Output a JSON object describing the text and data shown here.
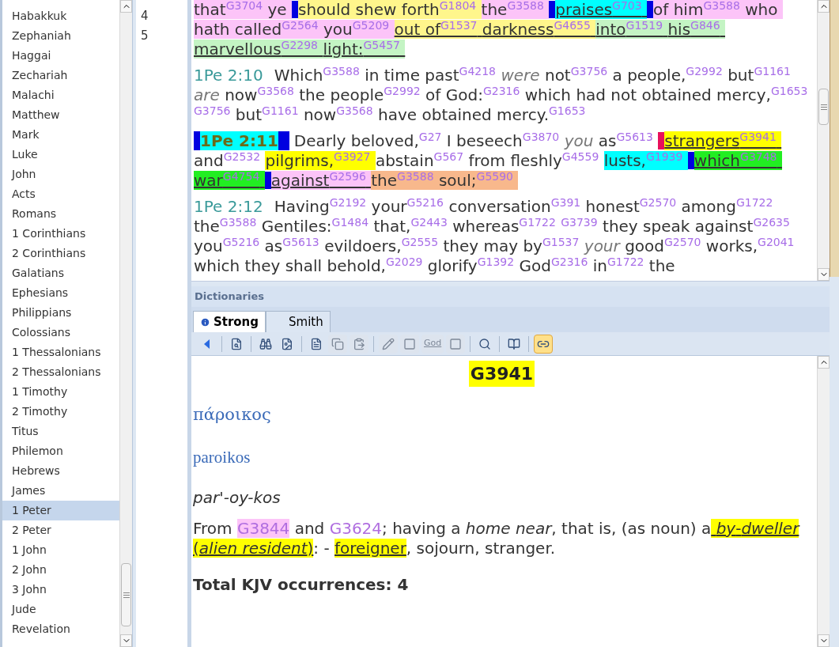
{
  "books": [
    {
      "name": "Habakkuk",
      "selected": false
    },
    {
      "name": "Zephaniah",
      "selected": false
    },
    {
      "name": "Haggai",
      "selected": false
    },
    {
      "name": "Zechariah",
      "selected": false
    },
    {
      "name": "Malachi",
      "selected": false
    },
    {
      "name": "Matthew",
      "selected": false
    },
    {
      "name": "Mark",
      "selected": false
    },
    {
      "name": "Luke",
      "selected": false
    },
    {
      "name": "John",
      "selected": false
    },
    {
      "name": "Acts",
      "selected": false
    },
    {
      "name": "Romans",
      "selected": false
    },
    {
      "name": "1 Corinthians",
      "selected": false
    },
    {
      "name": "2 Corinthians",
      "selected": false
    },
    {
      "name": "Galatians",
      "selected": false
    },
    {
      "name": "Ephesians",
      "selected": false
    },
    {
      "name": "Philippians",
      "selected": false
    },
    {
      "name": "Colossians",
      "selected": false
    },
    {
      "name": "1 Thessalonians",
      "selected": false
    },
    {
      "name": "2 Thessalonians",
      "selected": false
    },
    {
      "name": "1 Timothy",
      "selected": false
    },
    {
      "name": "2 Timothy",
      "selected": false
    },
    {
      "name": "Titus",
      "selected": false
    },
    {
      "name": "Philemon",
      "selected": false
    },
    {
      "name": "Hebrews",
      "selected": false
    },
    {
      "name": "James",
      "selected": false
    },
    {
      "name": "1 Peter",
      "selected": true
    },
    {
      "name": "2 Peter",
      "selected": false
    },
    {
      "name": "1 John",
      "selected": false
    },
    {
      "name": "2 John",
      "selected": false
    },
    {
      "name": "3 John",
      "selected": false
    },
    {
      "name": "Jude",
      "selected": false
    },
    {
      "name": "Revelation",
      "selected": false
    }
  ],
  "chapters": [
    "4",
    "5"
  ],
  "verses": [
    {
      "tokens": [
        {
          "kind": "word",
          "w": "that",
          "s": "G3704",
          "color": "#fcc4f8"
        },
        {
          "kind": "word",
          "w": "ye",
          "color": "#fcc4f8"
        },
        {
          "kind": "bar",
          "color": "#0000e0"
        },
        {
          "kind": "word",
          "w": "should shew forth",
          "s": "G1804",
          "color": "#fff68c"
        },
        {
          "kind": "word",
          "w": "the",
          "s": "G3588",
          "color": "#fcc4f8"
        },
        {
          "kind": "bar",
          "color": "#0000e0"
        },
        {
          "kind": "underlined",
          "w": "praises",
          "s": "G703",
          "color": "#00ffff"
        },
        {
          "kind": "bar",
          "color": "#0000e0"
        },
        {
          "kind": "word",
          "w": "of him",
          "s": "G3588",
          "color": "#fcc4f8"
        },
        {
          "kind": "word",
          "w": "who",
          "color": "#fcc4f8"
        },
        {
          "kind": "word",
          "w": "hath called",
          "s": "G2564",
          "color": "#fcc4f8"
        },
        {
          "kind": "word",
          "w": "you",
          "s": "G5209",
          "color": "#fcc4f8"
        },
        {
          "kind": "underlined",
          "w": "out of",
          "s": "G1537",
          "color": "#fff68c"
        },
        {
          "kind": "underlined",
          "w": "darkness",
          "s": "G4655",
          "color": "#fff68c"
        },
        {
          "kind": "underlined",
          "w": "into",
          "s": "G1519",
          "color": "#c4f4c4"
        },
        {
          "kind": "underlined",
          "w": "his",
          "s": "G846",
          "color": "#c4f4c4"
        },
        {
          "kind": "underlined",
          "w": "marvellous",
          "s": "G2298",
          "color": "#c4f4c4"
        },
        {
          "kind": "underlined",
          "w": "light:",
          "s": "G5457",
          "color": "#c4f4c4"
        }
      ]
    },
    {
      "ref": "1Pe 2:10",
      "selected": false,
      "tokens": [
        {
          "kind": "word",
          "w": "Which",
          "s": "G3588"
        },
        {
          "kind": "word",
          "w": "in time past",
          "s": "G4218"
        },
        {
          "kind": "italic",
          "w": "were"
        },
        {
          "kind": "word",
          "w": "not",
          "s": "G3756"
        },
        {
          "kind": "word",
          "w": "a people,",
          "s": "G2992"
        },
        {
          "kind": "word",
          "w": "but",
          "s": "G1161"
        },
        {
          "kind": "italic",
          "w": "are"
        },
        {
          "kind": "word",
          "w": "now",
          "s": "G3568"
        },
        {
          "kind": "word",
          "w": "the people",
          "s": "G2992"
        },
        {
          "kind": "word",
          "w": "of God:",
          "s": "G2316"
        },
        {
          "kind": "word",
          "w": "which had not obtained"
        },
        {
          "kind": "word",
          "w": "mercy,",
          "s": "G1653"
        },
        {
          "kind": "word",
          "s": "G3756"
        },
        {
          "kind": "word",
          "w": "but",
          "s": "G1161"
        },
        {
          "kind": "word",
          "w": "now",
          "s": "G3568"
        },
        {
          "kind": "word",
          "w": "have obtained mercy.",
          "s": "G1653"
        }
      ]
    },
    {
      "ref": "1Pe 2:11",
      "selected": true,
      "tokens": [
        {
          "kind": "word",
          "w": "Dearly beloved,",
          "s": "G27"
        },
        {
          "kind": "word",
          "w": "I beseech",
          "s": "G3870"
        },
        {
          "kind": "italic",
          "w": "you"
        },
        {
          "kind": "word",
          "w": "as",
          "s": "G5613"
        },
        {
          "kind": "bar",
          "color": "#e8105c"
        },
        {
          "kind": "underlined",
          "w": "strangers",
          "s": "G3941",
          "color": "#ffff00"
        },
        {
          "kind": "word",
          "w": "and",
          "s": "G2532"
        },
        {
          "kind": "word",
          "w": "pilgrims,",
          "s": "G3927",
          "color": "#ffff00"
        },
        {
          "kind": "word",
          "w": "abstain",
          "s": "G567"
        },
        {
          "kind": "word",
          "w": "from fleshly",
          "s": "G4559"
        },
        {
          "kind": "word",
          "w": "lusts,",
          "s": "G1939",
          "color": "#00ffff"
        },
        {
          "kind": "bar",
          "color": "#0000e0"
        },
        {
          "kind": "underlined",
          "w": "which",
          "s": "G3748",
          "color": "#22ee22"
        },
        {
          "kind": "underlined",
          "w": "war",
          "s": "G4754",
          "color": "#22ee22"
        },
        {
          "kind": "bar",
          "color": "#0000e0"
        },
        {
          "kind": "underlined",
          "w": "against",
          "s": "G2596",
          "color": "#fcc4f8"
        },
        {
          "kind": "word",
          "w": "the",
          "s": "G3588",
          "color": "#f8b88c"
        },
        {
          "kind": "word",
          "w": "soul;",
          "s": "G5590",
          "color": "#f8b88c"
        }
      ]
    },
    {
      "ref": "1Pe 2:12",
      "selected": false,
      "tokens": [
        {
          "kind": "word",
          "w": "Having",
          "s": "G2192"
        },
        {
          "kind": "word",
          "w": "your",
          "s": "G5216"
        },
        {
          "kind": "word",
          "w": "conversation",
          "s": "G391"
        },
        {
          "kind": "word",
          "w": "honest",
          "s": "G2570"
        },
        {
          "kind": "word",
          "w": "among",
          "s": "G1722"
        },
        {
          "kind": "word",
          "w": "the",
          "s": "G3588"
        },
        {
          "kind": "word",
          "w": "Gentiles:",
          "s": "G1484"
        },
        {
          "kind": "word",
          "w": "that,",
          "s": "G2443"
        },
        {
          "kind": "word",
          "w": "whereas",
          "s": "G1722"
        },
        {
          "kind": "word",
          "s": "G3739"
        },
        {
          "kind": "word",
          "w": "they speak against",
          "s": "G2635"
        },
        {
          "kind": "word",
          "w": "you",
          "s": "G5216"
        },
        {
          "kind": "word",
          "w": "as",
          "s": "G5613"
        },
        {
          "kind": "word",
          "w": "evildoers,",
          "s": "G2555"
        },
        {
          "kind": "word",
          "w": "they may by",
          "s": "G1537"
        },
        {
          "kind": "italic",
          "w": "your"
        },
        {
          "kind": "word",
          "w": "good",
          "s": "G2570"
        },
        {
          "kind": "word",
          "w": "works,",
          "s": "G2041"
        },
        {
          "kind": "word",
          "w": "which they shall behold,",
          "s": "G2029"
        },
        {
          "kind": "word",
          "w": "glorify",
          "s": "G1392"
        },
        {
          "kind": "word",
          "w": "God",
          "s": "G2316"
        },
        {
          "kind": "word",
          "w": "in",
          "s": "G1722"
        },
        {
          "kind": "word",
          "w": "the"
        }
      ]
    }
  ],
  "dictionaries": {
    "title": "Dictionaries",
    "tabs": [
      {
        "label": "Strong",
        "selected": true
      },
      {
        "label": "Smith",
        "selected": false
      }
    ],
    "toolbar": [
      {
        "kind": "back",
        "disabled": false,
        "active": false
      },
      {
        "kind": "sep"
      },
      {
        "kind": "lookup",
        "disabled": false,
        "active": false
      },
      {
        "kind": "sep"
      },
      {
        "kind": "find",
        "disabled": false,
        "active": false
      },
      {
        "kind": "find-doc",
        "disabled": false,
        "active": false
      },
      {
        "kind": "sep"
      },
      {
        "kind": "doc",
        "disabled": false,
        "active": false
      },
      {
        "kind": "copy",
        "disabled": true,
        "active": false
      },
      {
        "kind": "paste",
        "disabled": true,
        "active": false
      },
      {
        "kind": "sep"
      },
      {
        "kind": "edit",
        "disabled": true,
        "active": false
      },
      {
        "kind": "blank",
        "disabled": true,
        "active": false
      },
      {
        "kind": "god",
        "label": "God",
        "disabled": true,
        "active": false
      },
      {
        "kind": "blank",
        "disabled": true,
        "active": false
      },
      {
        "kind": "sep"
      },
      {
        "kind": "zoom",
        "disabled": false,
        "active": false
      },
      {
        "kind": "sep"
      },
      {
        "kind": "book",
        "disabled": false,
        "active": false
      },
      {
        "kind": "sep"
      },
      {
        "kind": "link",
        "disabled": false,
        "active": true
      }
    ],
    "entry": {
      "number": "G3941",
      "greek": "πάροικος",
      "translit": "paroikos",
      "pronunciation": "par'-oy-kos",
      "definition": [
        {
          "kind": "plain",
          "t": "From "
        },
        {
          "kind": "link",
          "t": "G3844",
          "color": "#fcc4f8"
        },
        {
          "kind": "plain",
          "t": " and "
        },
        {
          "kind": "link",
          "t": "G3624"
        },
        {
          "kind": "plain",
          "t": "; having a *home near*, that is, (as noun) a"
        },
        {
          "kind": "highlight",
          "t": " *by*-*dweller* (*alien resident*)"
        },
        {
          "kind": "plain",
          "t": ": - "
        },
        {
          "kind": "highlight",
          "t": " foreigner"
        },
        {
          "kind": "plain",
          "t": ", sojourn, stranger."
        }
      ],
      "total": "Total KJV occurrences: 4"
    }
  }
}
